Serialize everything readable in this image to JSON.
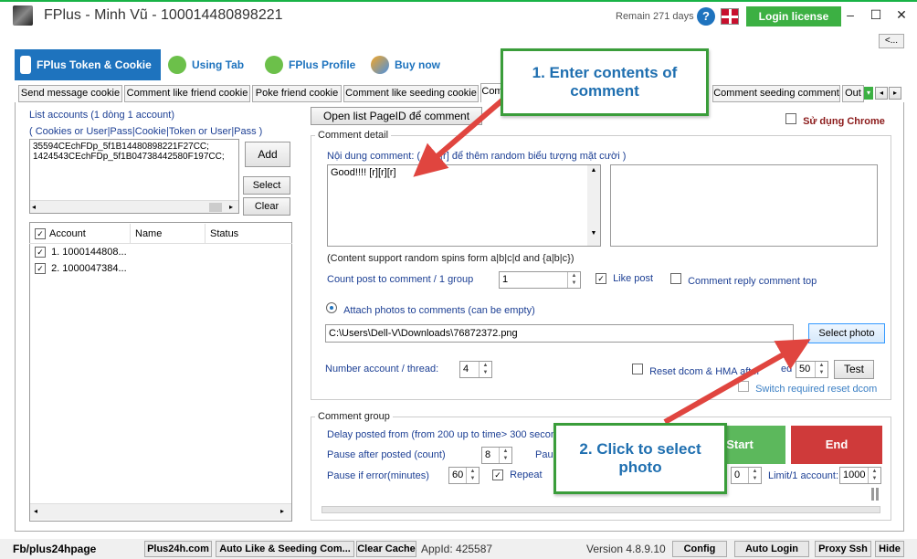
{
  "window": {
    "title": "FPlus - Minh Vũ - 100014480898221",
    "remain": "Remain 271 days",
    "login_label": "Login license",
    "collapse_label": "<...",
    "min": "–",
    "max": "☐",
    "close": "✕",
    "help": "?"
  },
  "main_tabs": [
    {
      "label": "FPlus Token & Cookie"
    },
    {
      "label": "Using Tab"
    },
    {
      "label": "FPlus Profile"
    },
    {
      "label": "Buy now"
    }
  ],
  "sub_tabs": [
    {
      "label": "Send message cookie"
    },
    {
      "label": "Comment like friend cookie"
    },
    {
      "label": "Poke friend cookie"
    },
    {
      "label": "Comment like seeding cookie"
    },
    {
      "label": "Com"
    },
    {
      "label": "Comment seeding comment"
    },
    {
      "label": "Out"
    }
  ],
  "left": {
    "list_label": "List accounts (1 dòng 1 account)",
    "list_hint": "( Cookies or User|Pass|Cookie|Token or User|Pass )",
    "accounts_text_1": "35594CEchFDp_5f1B14480898221F27CC;",
    "accounts_text_2": "1424543CEchFDp_5f1B04738442580F197CC;",
    "add": "Add",
    "select": "Select",
    "clear": "Clear",
    "grid_headers": [
      "Account",
      "Name",
      "Status"
    ],
    "rows": [
      {
        "account": "1. 1000144808..."
      },
      {
        "account": "2. 1000047384..."
      }
    ]
  },
  "right": {
    "open_list": "Open list PageID để comment",
    "use_chrome": "Sử dụng Chrome",
    "comment_detail": "Comment detail",
    "content_label_a": "Nội dung comment: ( th",
    "content_label_b": "[r] để thêm random biểu tượng mặt cười )",
    "comment_value": "Good!!!! [r][r][r]",
    "spin_note": "(Content support random spins form a|b|c|d and {a|b|c})",
    "count_label": "Count post to comment / 1 group",
    "count_value": "1",
    "like_post": "Like post",
    "reply_top": "Comment reply comment top",
    "attach_label": "Attach photos to comments (can be empty)",
    "photo_path": "C:\\Users\\Dell-V\\Downloads\\76872372.png",
    "select_photo": "Select photo",
    "num_thread_label": "Number account / thread:",
    "num_thread_value": "4",
    "reset_label_a": "Reset dcom & HMA after",
    "reset_label_b": "ed",
    "reset_value": "50",
    "test": "Test",
    "switch_label": "Switch required reset dcom",
    "comment_group": "Comment group",
    "delay_label": "Delay posted from (from 200 up to time> 300 second",
    "pause_after_label": "Pause after posted (count)",
    "pause_after_value": "8",
    "pau_cut": "Pau",
    "pause_error_label": "Pause if error(minutes)",
    "pause_error_value": "60",
    "repeat": "Repeat",
    "zero_value": "0",
    "limit_label": "Limit/1 account:",
    "limit_value": "1000",
    "start": "Start",
    "end": "End"
  },
  "callouts": {
    "one": "1. Enter contents of comment",
    "two": "2. Click to select photo"
  },
  "status": {
    "page": "Fb/plus24hpage",
    "buttons": [
      "Plus24h.com",
      "Auto Like & Seeding Com...",
      "Clear Cache"
    ],
    "appid": "AppId: 425587",
    "version": "Version 4.8.9.10",
    "right_buttons": [
      "Config",
      "Auto Login",
      "Proxy Ssh",
      "Hide"
    ]
  },
  "colors": {
    "accent_blue": "#1e73be",
    "green": "#3cb043",
    "red": "#cf3a3a",
    "callout_border": "#3a9d3a",
    "arrow": "#e0453f"
  }
}
